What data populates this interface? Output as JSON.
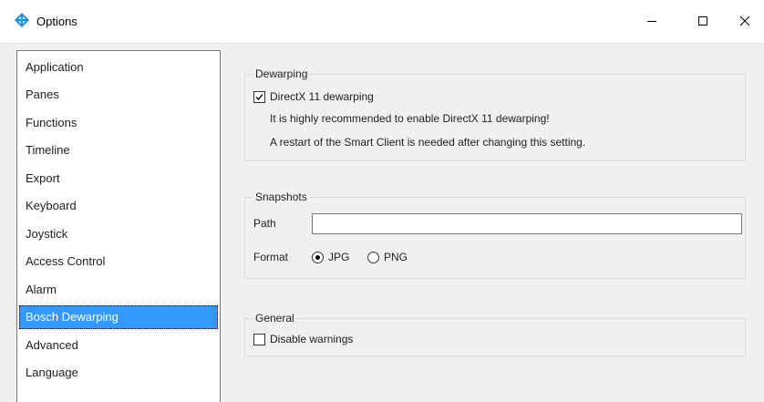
{
  "window": {
    "title": "Options",
    "icon": "options-diamond-icon",
    "controls": {
      "minimize": "minimize-icon",
      "maximize": "maximize-icon",
      "close": "close-icon"
    }
  },
  "sidebar": {
    "items": [
      {
        "label": "Application"
      },
      {
        "label": "Panes"
      },
      {
        "label": "Functions"
      },
      {
        "label": "Timeline"
      },
      {
        "label": "Export"
      },
      {
        "label": "Keyboard"
      },
      {
        "label": "Joystick"
      },
      {
        "label": "Access Control"
      },
      {
        "label": "Alarm"
      },
      {
        "label": "Bosch Dewarping",
        "selected": true
      },
      {
        "label": "Advanced"
      },
      {
        "label": "Language"
      }
    ]
  },
  "dewarping": {
    "title": "Dewarping",
    "checkbox_label": "DirectX 11 dewarping",
    "checked": true,
    "note1": "It is highly recommended to enable DirectX 11 dewarping!",
    "note2": "A restart of the Smart Client is needed after changing this setting."
  },
  "snapshots": {
    "title": "Snapshots",
    "path_label": "Path",
    "path_value": "",
    "format_label": "Format",
    "options": [
      {
        "label": "JPG",
        "selected": true
      },
      {
        "label": "PNG",
        "selected": false
      }
    ]
  },
  "general": {
    "title": "General",
    "checkbox_label": "Disable warnings",
    "checked": false
  },
  "colors": {
    "selection": "#3399ff",
    "background": "#f0f0f0",
    "accent_icon": "#1e90e0"
  }
}
